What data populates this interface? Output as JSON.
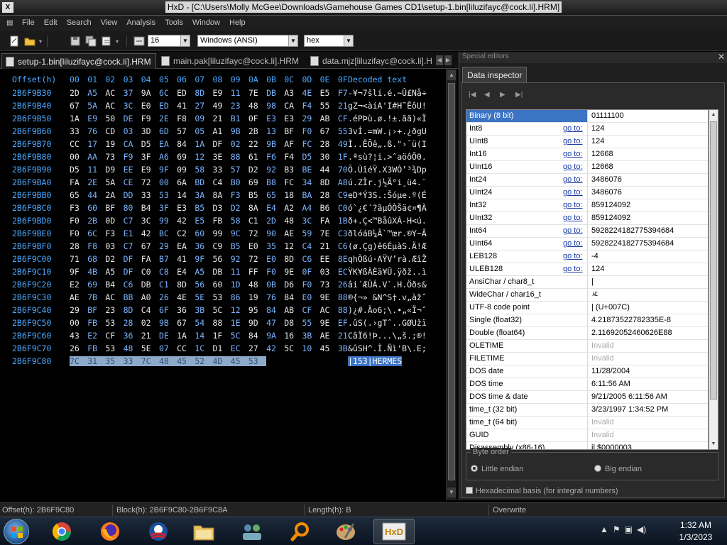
{
  "window": {
    "app_icon": "X",
    "title": "HxD - [C:\\Users\\Molly McGee\\Downloads\\Gamehouse Games CD1\\setup-1.bin[liluzifayc@cock.li].HRM]"
  },
  "menu": [
    "File",
    "Edit",
    "Search",
    "View",
    "Analysis",
    "Tools",
    "Window",
    "Help"
  ],
  "toolbar": {
    "bytes_per_row": "16",
    "charset": "Windows (ANSI)",
    "offset_base": "hex"
  },
  "tabs": [
    {
      "label": "setup-1.bin[liluzifayc@cock.li].HRM",
      "active": true
    },
    {
      "label": "main.pak[liluzifayc@cock.li].HRM",
      "active": false
    },
    {
      "label": "data.mjz[liluzifayc@cock.li].H",
      "active": false
    }
  ],
  "hex": {
    "offset_header": "Offset(h)",
    "columns": [
      "00",
      "01",
      "02",
      "03",
      "04",
      "05",
      "06",
      "07",
      "08",
      "09",
      "0A",
      "0B",
      "0C",
      "0D",
      "0E",
      "0F"
    ],
    "decoded_header": "Decoded text",
    "rows": [
      {
        "offset": "2B6F9B30",
        "bytes": [
          "2D",
          "A5",
          "AC",
          "37",
          "9A",
          "6C",
          "ED",
          "8D",
          "E9",
          "11",
          "7E",
          "DB",
          "A3",
          "4E",
          "E5",
          "F7"
        ],
        "text": "-¥¬7šlí.é.~Û£Nå÷"
      },
      {
        "offset": "2B6F9B40",
        "bytes": [
          "67",
          "5A",
          "AC",
          "3C",
          "E0",
          "ED",
          "41",
          "27",
          "49",
          "23",
          "48",
          "98",
          "CA",
          "F4",
          "55",
          "21"
        ],
        "text": "gZ¬<àíA'I#H˜ÊôU!"
      },
      {
        "offset": "2B6F9B50",
        "bytes": [
          "1A",
          "E9",
          "50",
          "DE",
          "F9",
          "2E",
          "F8",
          "09",
          "21",
          "B1",
          "0F",
          "E3",
          "E3",
          "29",
          "AB",
          "CF"
        ],
        "text": ".éPÞù.ø.!±.ãã)«Ï"
      },
      {
        "offset": "2B6F9B60",
        "bytes": [
          "33",
          "76",
          "CD",
          "03",
          "3D",
          "6D",
          "57",
          "05",
          "A1",
          "9B",
          "2B",
          "13",
          "BF",
          "F0",
          "67",
          "55"
        ],
        "text": "3vÍ.=mW.¡›+.¿ðgU"
      },
      {
        "offset": "2B6F9B70",
        "bytes": [
          "CC",
          "17",
          "19",
          "CA",
          "D5",
          "EA",
          "84",
          "1A",
          "DF",
          "02",
          "22",
          "9B",
          "AF",
          "FC",
          "28",
          "49"
        ],
        "text": "Ì..ÊÕê„.ß.\"›¯ü(I"
      },
      {
        "offset": "2B6F9B80",
        "bytes": [
          "00",
          "AA",
          "73",
          "F9",
          "3F",
          "A6",
          "69",
          "12",
          "3E",
          "88",
          "61",
          "F6",
          "F4",
          "D5",
          "30",
          "1F"
        ],
        "text": ".ªsù?¦i.>ˆaöôÕ0."
      },
      {
        "offset": "2B6F9B90",
        "bytes": [
          "D5",
          "11",
          "D9",
          "EE",
          "E9",
          "9F",
          "09",
          "58",
          "33",
          "57",
          "D2",
          "92",
          "B3",
          "BE",
          "44",
          "70"
        ],
        "text": "Õ.ÙîéŸ.X3WÒ’³¾Dp"
      },
      {
        "offset": "2B6F9BA0",
        "bytes": [
          "FA",
          "2E",
          "5A",
          "CE",
          "72",
          "00",
          "6A",
          "BD",
          "C4",
          "B0",
          "69",
          "B8",
          "FC",
          "34",
          "8D",
          "A8"
        ],
        "text": "ú.ZÎr.j½Ä°i¸ü4.¨"
      },
      {
        "offset": "2B6F9BB0",
        "bytes": [
          "65",
          "44",
          "2A",
          "DD",
          "33",
          "53",
          "14",
          "3A",
          "8A",
          "F3",
          "B5",
          "65",
          "18",
          "BA",
          "28",
          "C9"
        ],
        "text": "eD*Ý3S.:Šóµe.º(É"
      },
      {
        "offset": "2B6F9BC0",
        "bytes": [
          "F3",
          "60",
          "BF",
          "80",
          "B4",
          "3F",
          "E3",
          "B5",
          "D3",
          "D2",
          "8A",
          "E4",
          "A2",
          "A4",
          "B6",
          "C0"
        ],
        "text": "ó`¿€´?ãµÓÒŠä¢¤¶À"
      },
      {
        "offset": "2B6F9BD0",
        "bytes": [
          "F0",
          "2B",
          "0D",
          "C7",
          "3C",
          "99",
          "42",
          "E5",
          "FB",
          "58",
          "C1",
          "2D",
          "48",
          "3C",
          "FA",
          "1B"
        ],
        "text": "ð+.Ç<™BåûXÁ-H<ú."
      },
      {
        "offset": "2B6F9BE0",
        "bytes": [
          "F0",
          "6C",
          "F3",
          "E1",
          "42",
          "BC",
          "C2",
          "60",
          "99",
          "9C",
          "72",
          "90",
          "AE",
          "59",
          "7E",
          "C3"
        ],
        "text": "ðlóáB¼Â`™œr.®Y~Ã"
      },
      {
        "offset": "2B6F9BF0",
        "bytes": [
          "28",
          "F8",
          "03",
          "C7",
          "67",
          "29",
          "EA",
          "36",
          "C9",
          "B5",
          "E0",
          "35",
          "12",
          "C4",
          "21",
          "C6"
        ],
        "text": "(ø.Çg)ê6ÉµàS.Ä!Æ"
      },
      {
        "offset": "2B6F9C00",
        "bytes": [
          "71",
          "68",
          "D2",
          "DF",
          "FA",
          "B7",
          "41",
          "9F",
          "56",
          "92",
          "72",
          "E0",
          "8D",
          "C6",
          "EE",
          "8E"
        ],
        "text": "qhÒßú·AŸV’rà.ÆîŽ"
      },
      {
        "offset": "2B6F9C10",
        "bytes": [
          "9F",
          "4B",
          "A5",
          "DF",
          "C0",
          "C8",
          "E4",
          "A5",
          "DB",
          "11",
          "FF",
          "F0",
          "9E",
          "0F",
          "03",
          "EC"
        ],
        "text": "ŸK¥ßÀÈä¥Û.ÿðž..ì"
      },
      {
        "offset": "2B6F9C20",
        "bytes": [
          "E2",
          "69",
          "B4",
          "C6",
          "DB",
          "C1",
          "8D",
          "56",
          "60",
          "1D",
          "48",
          "0B",
          "D6",
          "F0",
          "73",
          "26"
        ],
        "text": "âi´ÆÛÁ.V`.H.Öðs&"
      },
      {
        "offset": "2B6F9C30",
        "bytes": [
          "AE",
          "7B",
          "AC",
          "BB",
          "A0",
          "26",
          "4E",
          "5E",
          "53",
          "86",
          "19",
          "76",
          "84",
          "E0",
          "9E",
          "88"
        ],
        "text": "®{¬» &N^S†.v„àžˆ"
      },
      {
        "offset": "2B6F9C40",
        "bytes": [
          "29",
          "BF",
          "23",
          "8D",
          "C4",
          "6F",
          "36",
          "3B",
          "5C",
          "12",
          "95",
          "84",
          "AB",
          "CF",
          "AC",
          "88"
        ],
        "text": ")¿#.Äo6;\\.•„«Ï¬ˆ"
      },
      {
        "offset": "2B6F9C50",
        "bytes": [
          "00",
          "FB",
          "53",
          "28",
          "02",
          "9B",
          "67",
          "54",
          "88",
          "1E",
          "9D",
          "47",
          "D8",
          "55",
          "9E",
          "EF"
        ],
        "text": ".ûS(.›gTˆ..GØUžï"
      },
      {
        "offset": "2B6F9C60",
        "bytes": [
          "43",
          "E2",
          "CF",
          "36",
          "21",
          "DE",
          "1A",
          "14",
          "1F",
          "5C",
          "84",
          "9A",
          "16",
          "3B",
          "AE",
          "21"
        ],
        "text": "CâÏ6!Þ...\\„š.;®!"
      },
      {
        "offset": "2B6F9C70",
        "bytes": [
          "26",
          "FB",
          "53",
          "48",
          "5E",
          "07",
          "CC",
          "1C",
          "D1",
          "EC",
          "27",
          "42",
          "5C",
          "10",
          "45",
          "3B"
        ],
        "text": "&ûSH^.Ì.Ñì'B\\.E;"
      },
      {
        "offset": "2B6F9C80",
        "bytes": [
          "7C",
          "31",
          "35",
          "33",
          "7C",
          "48",
          "45",
          "52",
          "4D",
          "45",
          "53"
        ],
        "text": "|153|HERMES",
        "selected": true
      }
    ]
  },
  "special_editors": {
    "header": "Special editors",
    "tab": "Data inspector",
    "goto_label": "go to:",
    "rows": [
      {
        "name": "Binary (8 bit)",
        "value": "01111100",
        "goto": false,
        "selected": true
      },
      {
        "name": "Int8",
        "value": "124",
        "goto": true
      },
      {
        "name": "UInt8",
        "value": "124",
        "goto": true
      },
      {
        "name": "Int16",
        "value": "12668",
        "goto": true
      },
      {
        "name": "UInt16",
        "value": "12668",
        "goto": true
      },
      {
        "name": "Int24",
        "value": "3486076",
        "goto": true
      },
      {
        "name": "UInt24",
        "value": "3486076",
        "goto": true
      },
      {
        "name": "Int32",
        "value": "859124092",
        "goto": true
      },
      {
        "name": "UInt32",
        "value": "859124092",
        "goto": true
      },
      {
        "name": "Int64",
        "value": "5928224182775394684",
        "goto": true
      },
      {
        "name": "UInt64",
        "value": "5928224182775394684",
        "goto": true
      },
      {
        "name": "LEB128",
        "value": "-4",
        "goto": true
      },
      {
        "name": "ULEB128",
        "value": "124",
        "goto": true
      },
      {
        "name": "AnsiChar / char8_t",
        "value": "|",
        "goto": false
      },
      {
        "name": "WideChar / char16_t",
        "value": "ㅼ",
        "goto": false
      },
      {
        "name": "UTF-8 code point",
        "value": "| (U+007C)",
        "goto": false
      },
      {
        "name": "Single (float32)",
        "value": "4.21873522782335E-8",
        "goto": false
      },
      {
        "name": "Double (float64)",
        "value": "2.11692052460626E88",
        "goto": false
      },
      {
        "name": "OLETIME",
        "value": "Invalid",
        "goto": false,
        "invalid": true
      },
      {
        "name": "FILETIME",
        "value": "Invalid",
        "goto": false,
        "invalid": true
      },
      {
        "name": "DOS date",
        "value": "11/28/2004",
        "goto": false
      },
      {
        "name": "DOS time",
        "value": "6:11:56 AM",
        "goto": false
      },
      {
        "name": "DOS time & date",
        "value": "9/21/2005 6:11:56 AM",
        "goto": false
      },
      {
        "name": "time_t (32 bit)",
        "value": "3/23/1997 1:34:52 PM",
        "goto": false
      },
      {
        "name": "time_t (64 bit)",
        "value": "Invalid",
        "goto": false,
        "invalid": true
      },
      {
        "name": "GUID",
        "value": "Invalid",
        "goto": false,
        "invalid": true
      },
      {
        "name": "Disassembly (x86-16)",
        "value": "jl $0000003",
        "goto": false
      }
    ],
    "byte_order": {
      "label": "Byte order",
      "little": "Little endian",
      "big": "Big endian",
      "selected": "little"
    },
    "hex_basis": "Hexadecimal basis (for integral numbers)"
  },
  "status": {
    "offset": "Offset(h): 2B6F9C80",
    "block": "Block(h): 2B6F9C80-2B6F9C8A",
    "length": "Length(h): B",
    "mode": "Overwrite"
  },
  "taskbar": {
    "apps": [
      "chrome-icon",
      "firefox-icon",
      "obama-icon",
      "explorer-icon",
      "network-icon",
      "search-icon",
      "paint-icon",
      "hxd-icon"
    ],
    "time": "1:32 AM",
    "date": "1/3/2023"
  }
}
